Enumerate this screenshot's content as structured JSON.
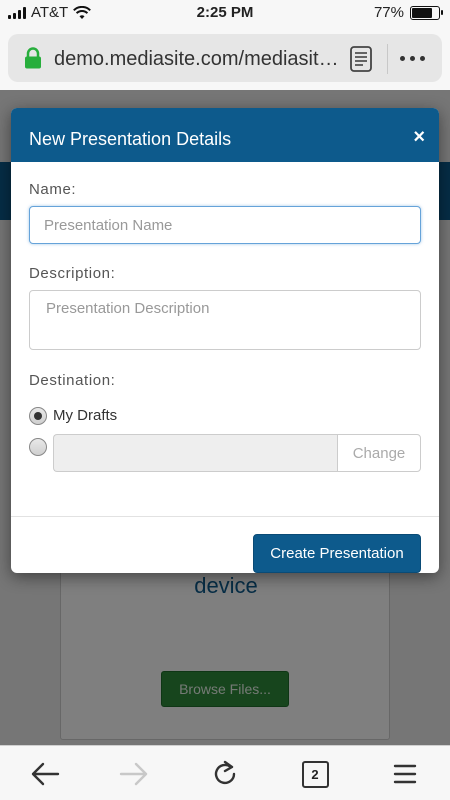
{
  "status_bar": {
    "carrier": "AT&T",
    "time": "2:25 PM",
    "battery_percent": "77%",
    "battery_level": 0.77
  },
  "browser": {
    "url": "demo.mediasite.com/mediasite/..."
  },
  "background": {
    "device_text": "device",
    "browse_button": "Browse Files..."
  },
  "modal": {
    "title": "New Presentation Details",
    "close_label": "×",
    "name_label": "Name:",
    "name_placeholder": "Presentation Name",
    "name_value": "",
    "description_label": "Description:",
    "description_placeholder": "Presentation Description",
    "description_value": "",
    "destination_label": "Destination:",
    "destination_options": [
      {
        "label": "My Drafts",
        "selected": true
      },
      {
        "label": "",
        "selected": false
      }
    ],
    "change_button": "Change",
    "create_button": "Create Presentation"
  },
  "toolbar": {
    "tabs_count": "2"
  },
  "colors": {
    "brand_blue": "#0d5a8c",
    "browse_green": "#2f8a3a"
  }
}
